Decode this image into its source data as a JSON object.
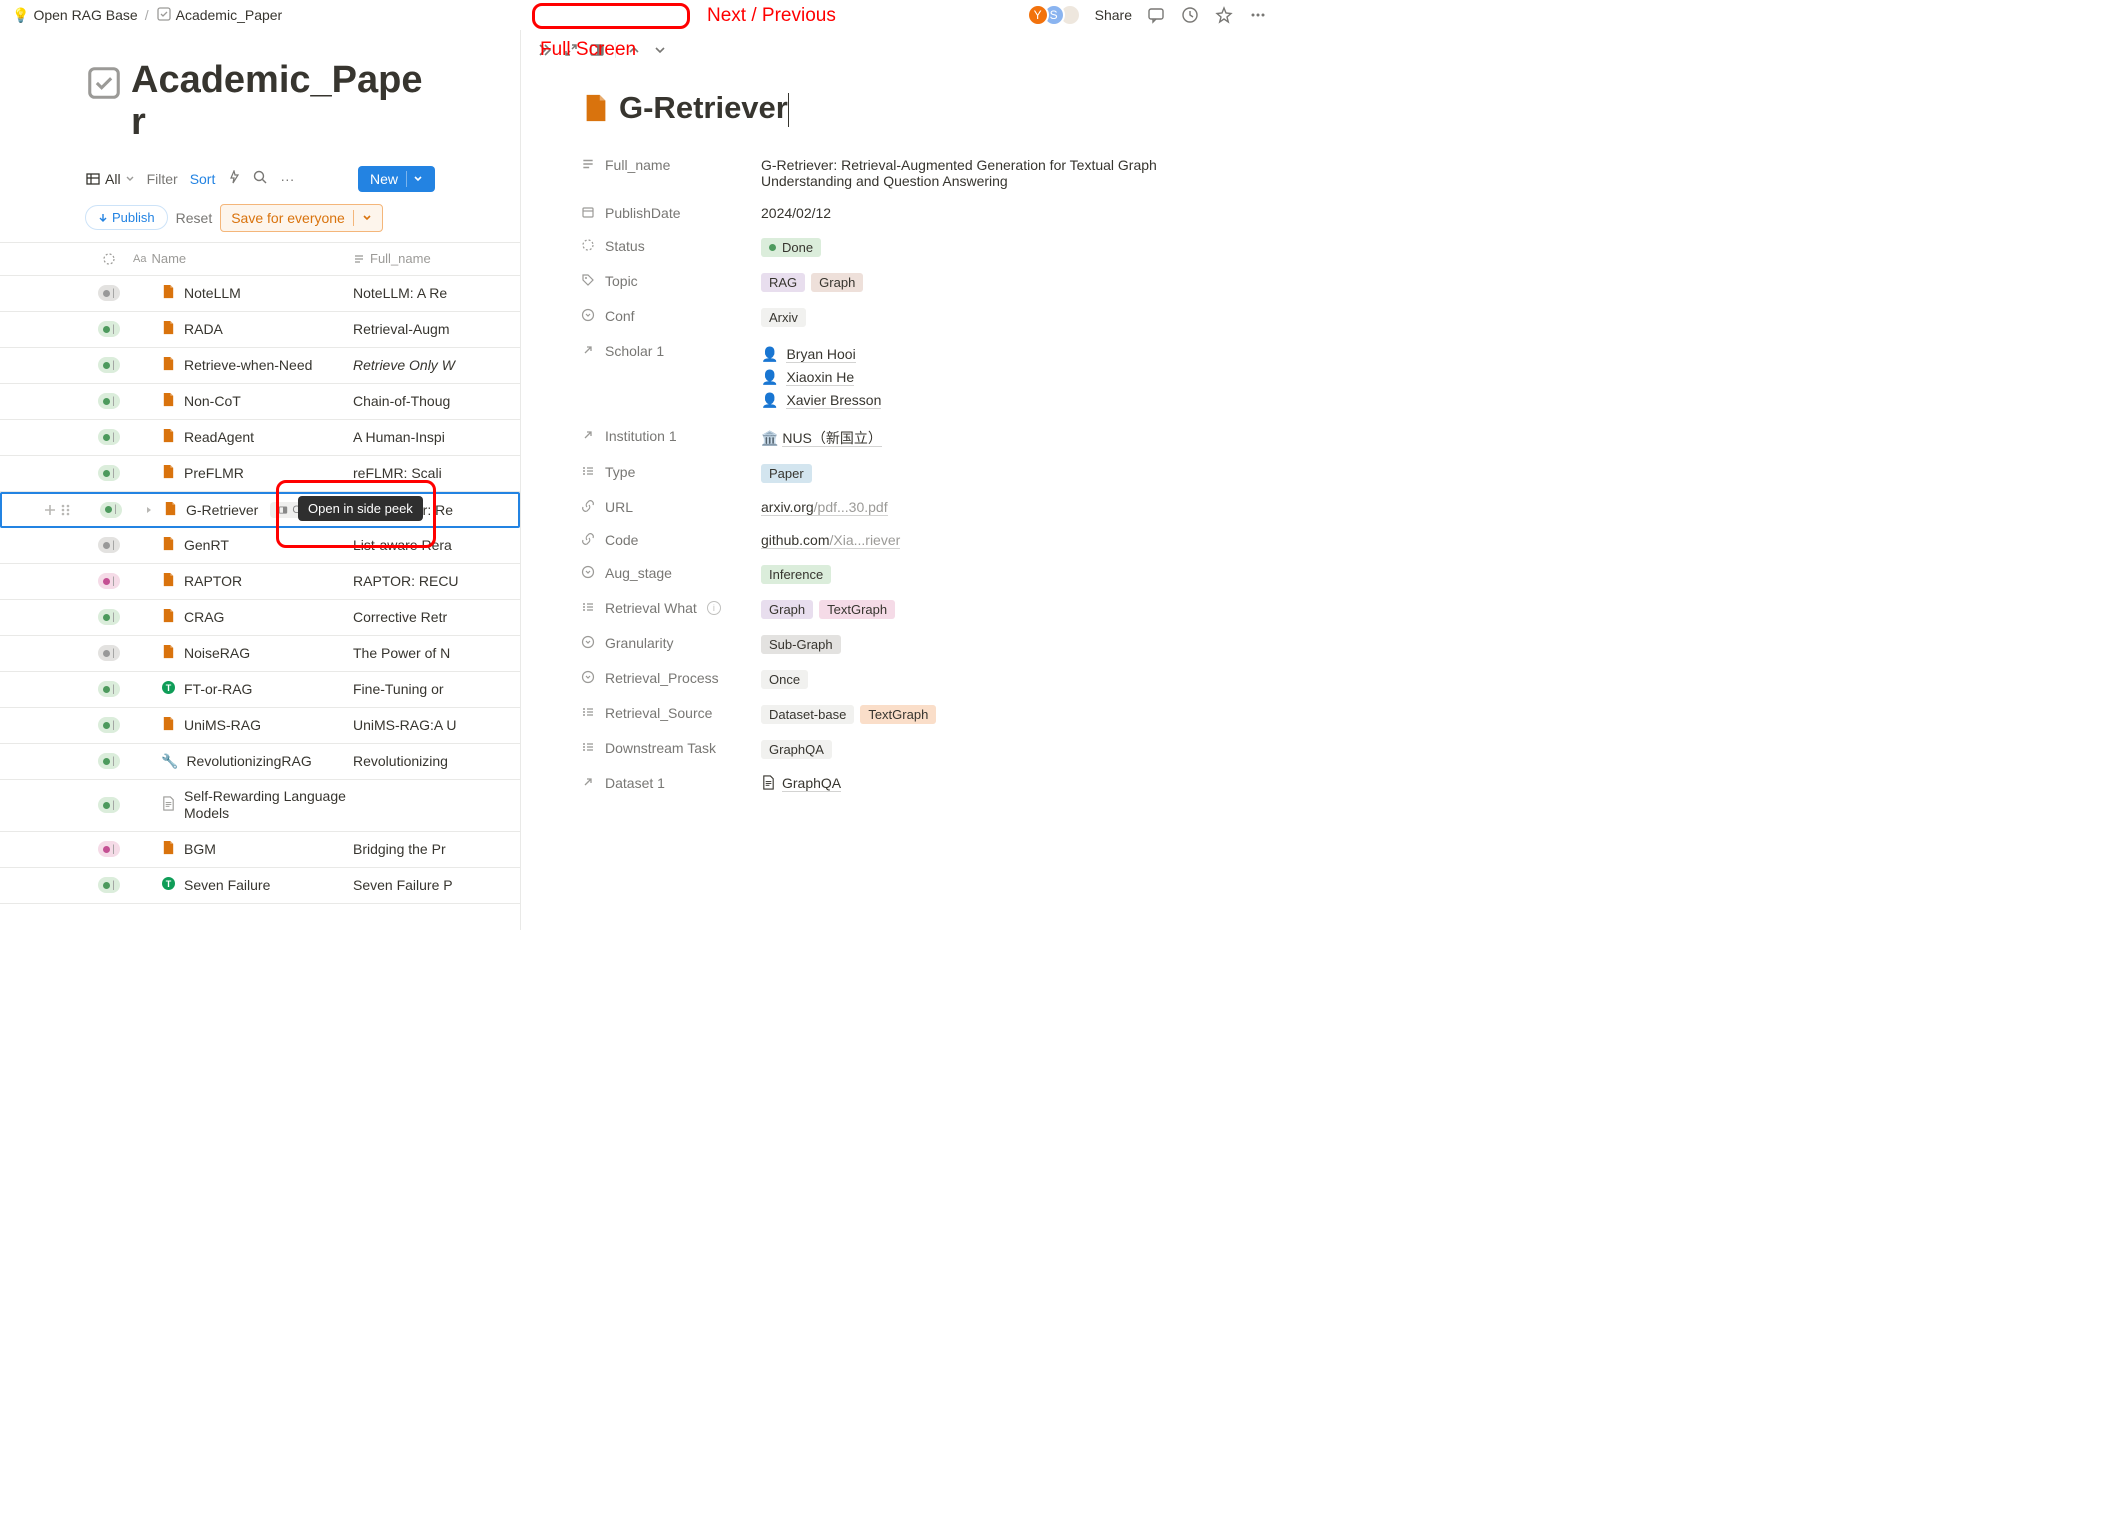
{
  "breadcrumb": {
    "root_icon": "💡",
    "root": "Open RAG Base",
    "current": "Academic_Paper"
  },
  "topbar": {
    "share": "Share",
    "avatars": [
      "Y",
      "S",
      ""
    ]
  },
  "page": {
    "title": "Academic_Paper"
  },
  "db": {
    "view": "All",
    "filter": "Filter",
    "sort": "Sort",
    "new": "New",
    "publish": "Publish",
    "reset": "Reset",
    "save": "Save for everyone",
    "col_name": "Name",
    "col_full": "Full_name"
  },
  "rows": [
    {
      "status": "gray",
      "name": "NoteLLM",
      "full": "NoteLLM: A Re"
    },
    {
      "status": "green",
      "name": "RADA",
      "full": "Retrieval-Augm"
    },
    {
      "status": "green",
      "name": "Retrieve-when-Need",
      "full": "Retrieve Only W",
      "italic": true
    },
    {
      "status": "green",
      "name": "Non-CoT",
      "full": "Chain-of-Thoug"
    },
    {
      "status": "green",
      "name": "ReadAgent",
      "full": "A Human-Inspi"
    },
    {
      "status": "green",
      "name": "PreFLMR",
      "full": "reFLMR: Scali"
    },
    {
      "status": "green",
      "name": "G-Retriever",
      "full": "G-Retriever: Re",
      "selected": true
    },
    {
      "status": "gray",
      "name": "GenRT",
      "full": "List-aware Rera"
    },
    {
      "status": "pink",
      "name": "RAPTOR",
      "full": "RAPTOR: RECU"
    },
    {
      "status": "green",
      "name": "CRAG",
      "full": "Corrective Retr"
    },
    {
      "status": "gray",
      "name": "NoiseRAG",
      "full": "The Power of N"
    },
    {
      "status": "green",
      "name": "FT-or-RAG",
      "full": "Fine-Tuning or",
      "icon": "green-badge"
    },
    {
      "status": "green",
      "name": "UniMS-RAG",
      "full": "UniMS-RAG:A U"
    },
    {
      "status": "green",
      "name": "RevolutionizingRAG",
      "full": "Revolutionizing",
      "icon": "wrench"
    },
    {
      "status": "green",
      "name": "Self-Rewarding Language Models",
      "full": "",
      "icon": "plain",
      "tall": true
    },
    {
      "status": "pink",
      "name": "BGM",
      "full": "Bridging the Pr"
    },
    {
      "status": "green",
      "name": "Seven Failure",
      "full": "Seven Failure P",
      "icon": "green-badge"
    }
  ],
  "tooltip": "Open in side peek",
  "open_chip": "OPEN",
  "annotations": {
    "next_prev": "Next / Previous",
    "full_screen": "Full Screen"
  },
  "peek": {
    "title": "G-Retriever",
    "props": {
      "full_name": {
        "label": "Full_name",
        "value": "G-Retriever: Retrieval-Augmented Generation for Textual Graph Understanding and Question Answering"
      },
      "publish_date": {
        "label": "PublishDate",
        "value": "2024/02/12"
      },
      "status": {
        "label": "Status",
        "value": "Done"
      },
      "topic": {
        "label": "Topic",
        "tags": [
          {
            "t": "RAG",
            "c": "purple"
          },
          {
            "t": "Graph",
            "c": "brown"
          }
        ]
      },
      "conf": {
        "label": "Conf",
        "tags": [
          {
            "t": "Arxiv",
            "c": "lightgray"
          }
        ]
      },
      "scholar": {
        "label": "Scholar 1",
        "people": [
          "Bryan Hooi",
          "Xiaoxin He",
          "Xavier Bresson"
        ]
      },
      "institution": {
        "label": "Institution 1",
        "icon": "🏛️",
        "value": "NUS（新国立）"
      },
      "type": {
        "label": "Type",
        "tags": [
          {
            "t": "Paper",
            "c": "blue"
          }
        ]
      },
      "url": {
        "label": "URL",
        "prefix": "arxiv.org",
        "suffix": "/pdf...30.pdf"
      },
      "code": {
        "label": "Code",
        "prefix": "github.com",
        "suffix": "/Xia...riever"
      },
      "aug_stage": {
        "label": "Aug_stage",
        "tags": [
          {
            "t": "Inference",
            "c": "green"
          }
        ]
      },
      "retrieval_what": {
        "label": "Retrieval What",
        "info": true,
        "tags": [
          {
            "t": "Graph",
            "c": "purple"
          },
          {
            "t": "TextGraph",
            "c": "pink"
          }
        ]
      },
      "granularity": {
        "label": "Granularity",
        "tags": [
          {
            "t": "Sub-Graph",
            "c": "gray"
          }
        ]
      },
      "retrieval_process": {
        "label": "Retrieval_Process",
        "tags": [
          {
            "t": "Once",
            "c": "lightgray"
          }
        ]
      },
      "retrieval_source": {
        "label": "Retrieval_Source",
        "tags": [
          {
            "t": "Dataset-base",
            "c": "lightgray"
          },
          {
            "t": "TextGraph",
            "c": "orange"
          }
        ]
      },
      "downstream": {
        "label": "Downstream Task",
        "tags": [
          {
            "t": "GraphQA",
            "c": "lightgray"
          }
        ]
      },
      "dataset": {
        "label": "Dataset 1",
        "link": "GraphQA"
      }
    }
  }
}
